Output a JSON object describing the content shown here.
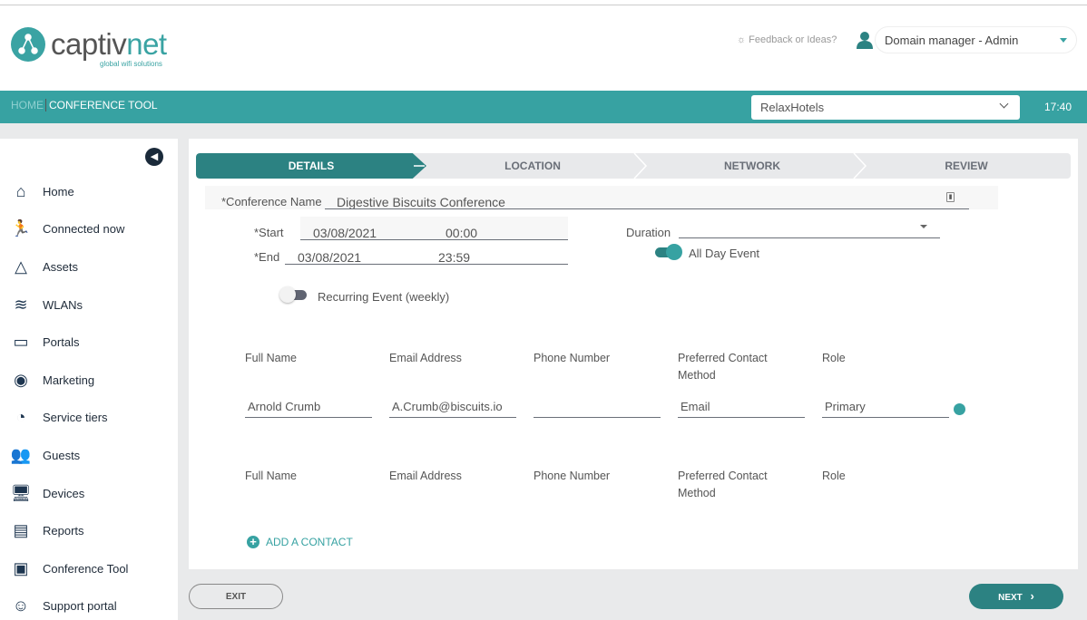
{
  "brand": {
    "name_a": "captiv",
    "name_b": "net",
    "tagline": "global wifi solutions"
  },
  "header": {
    "feedback": "Feedback or Ideas?",
    "role": "Domain manager - Admin"
  },
  "nav": {
    "home": "HOME",
    "current": "CONFERENCE TOOL",
    "property": "RelaxHotels",
    "time": "17:40"
  },
  "sidebar": {
    "items": [
      {
        "label": "Home",
        "icon": "home-icon"
      },
      {
        "label": "Connected now",
        "icon": "running-person-icon"
      },
      {
        "label": "Assets",
        "icon": "network-triangle-icon"
      },
      {
        "label": "WLANs",
        "icon": "wifi-icon"
      },
      {
        "label": "Portals",
        "icon": "portal-icon"
      },
      {
        "label": "Marketing",
        "icon": "marketing-icon"
      },
      {
        "label": "Service tiers",
        "icon": "speed-icon"
      },
      {
        "label": "Guests",
        "icon": "guests-icon"
      },
      {
        "label": "Devices",
        "icon": "devices-icon"
      },
      {
        "label": "Reports",
        "icon": "reports-icon"
      },
      {
        "label": "Conference Tool",
        "icon": "conference-icon"
      },
      {
        "label": "Support portal",
        "icon": "support-icon"
      }
    ]
  },
  "steps": [
    "DETAILS",
    "LOCATION",
    "NETWORK",
    "REVIEW"
  ],
  "form": {
    "conf_label": "*Conference Name",
    "conf_value": "Digestive Biscuits Conference",
    "start_label": "*Start",
    "start_date": "03/08/2021",
    "start_time": "00:00",
    "end_label": "*End",
    "end_date": "03/08/2021",
    "end_time": "23:59",
    "duration_label": "Duration",
    "all_day": "All Day Event",
    "recurring": "Recurring Event (weekly)"
  },
  "contacts": {
    "headers": [
      "Full Name",
      "Email Address",
      "Phone Number",
      "Preferred Contact Method",
      "Role"
    ],
    "rows": [
      [
        "Arnold Crumb",
        "A.Crumb@biscuits.io",
        "",
        "Email",
        "Primary"
      ]
    ],
    "add": "ADD A CONTACT"
  },
  "footer": {
    "exit": "EXIT",
    "next": "NEXT"
  }
}
